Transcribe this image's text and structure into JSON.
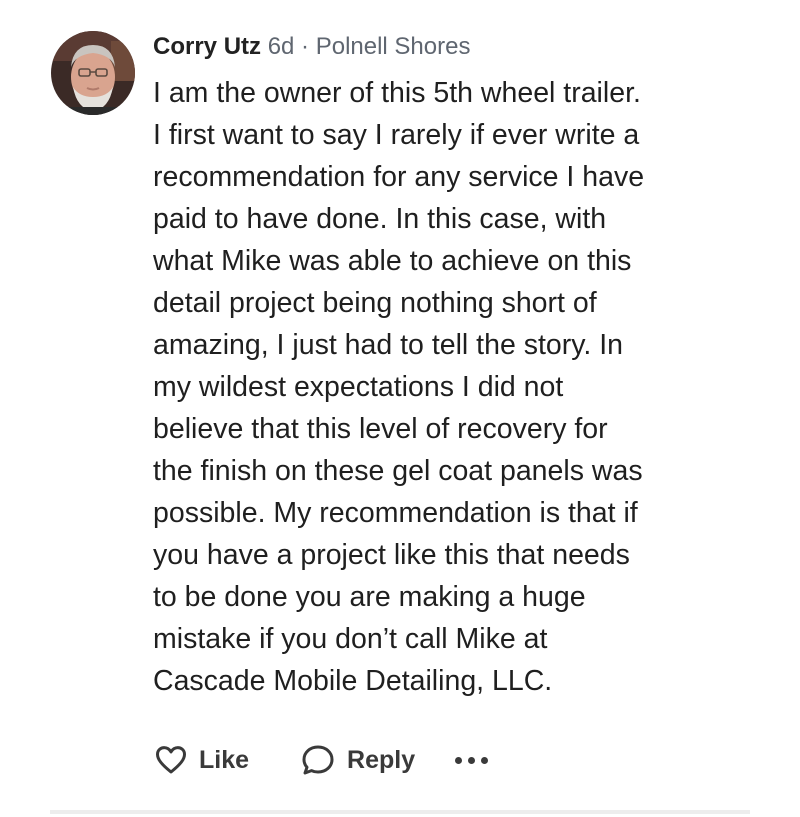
{
  "comment": {
    "author": "Corry Utz",
    "meta": "6d · Polnell Shores",
    "lines": [
      "I am the owner of this 5th wheel trailer.",
      "I first want to say I rarely if ever write a",
      "recommendation for any service I have",
      "paid to have done. In this case, with",
      "what Mike was able to achieve on this",
      "detail project being nothing short of",
      "amazing, I just had to tell the story. In",
      "my wildest expectations I did not",
      "believe that this level of recovery for",
      "the finish on these gel coat panels was",
      "possible. My recommendation is that if",
      "you have a project like this that needs",
      "to be done you are making a huge",
      "mistake if you don’t call Mike at",
      "Cascade Mobile Detailing, LLC."
    ]
  },
  "actions": {
    "like_label": "Like",
    "reply_label": "Reply",
    "like_icon": "heart-outline-icon",
    "reply_icon": "speech-bubble-icon",
    "more_icon": "more-dots-icon"
  },
  "colors": {
    "text": "#1f1f1f",
    "meta": "#5f6670",
    "action": "#3a3a3a",
    "divider": "#ededed"
  }
}
